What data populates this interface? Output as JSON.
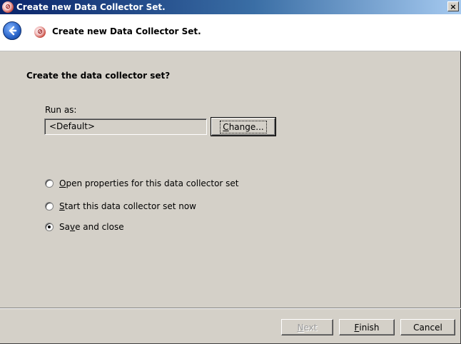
{
  "window": {
    "title": "Create new Data Collector Set.",
    "close_glyph": "×",
    "title_icon": "performance-monitor-icon"
  },
  "header": {
    "title": "Create new Data Collector Set.",
    "back_icon": "back-arrow-icon",
    "icon": "performance-monitor-icon"
  },
  "content": {
    "question": "Create the data collector set?",
    "run_as_label": "Run as:",
    "run_as_value": "<Default>",
    "change_button": {
      "pre": "",
      "ul": "C",
      "post": "hange..."
    },
    "options": [
      {
        "pre": "",
        "ul": "O",
        "post": "pen properties for this data collector set",
        "checked": false
      },
      {
        "pre": "",
        "ul": "S",
        "post": "tart this data collector set now",
        "checked": false
      },
      {
        "pre": "Sa",
        "ul": "v",
        "post": "e and close",
        "checked": true
      }
    ]
  },
  "footer": {
    "next": {
      "pre": "",
      "ul": "N",
      "post": "ext",
      "enabled": false
    },
    "finish": {
      "pre": "",
      "ul": "F",
      "post": "inish",
      "enabled": true
    },
    "cancel": {
      "label": "Cancel"
    }
  },
  "colors": {
    "titlebar_start": "#0a246a",
    "titlebar_end": "#a6caf0",
    "dialog_bg": "#d4d0c8",
    "header_bg": "#ffffff"
  }
}
